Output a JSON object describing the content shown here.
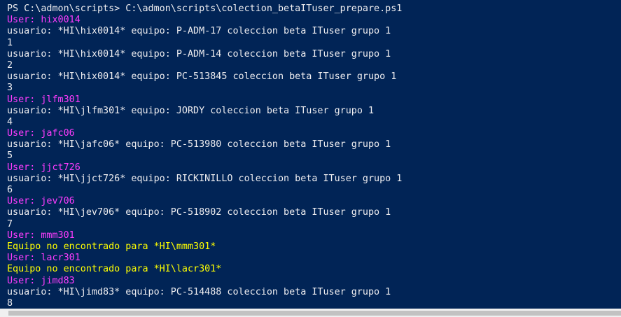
{
  "console": {
    "lines": [
      {
        "kind": "normal",
        "text": "PS C:\\admon\\scripts> C:\\admon\\scripts\\colection_betaITuser_prepare.ps1"
      },
      {
        "kind": "user",
        "text": "User: hix0014"
      },
      {
        "kind": "normal",
        "text": "usuario: *HI\\hix0014* equipo: P-ADM-17 coleccion beta ITuser grupo 1"
      },
      {
        "kind": "normal",
        "text": "1"
      },
      {
        "kind": "normal",
        "text": "usuario: *HI\\hix0014* equipo: P-ADM-14 coleccion beta ITuser grupo 1"
      },
      {
        "kind": "normal",
        "text": "2"
      },
      {
        "kind": "normal",
        "text": "usuario: *HI\\hix0014* equipo: PC-513845 coleccion beta ITuser grupo 1"
      },
      {
        "kind": "normal",
        "text": "3"
      },
      {
        "kind": "user",
        "text": "User: jlfm301"
      },
      {
        "kind": "normal",
        "text": "usuario: *HI\\jlfm301* equipo: JORDY coleccion beta ITuser grupo 1"
      },
      {
        "kind": "normal",
        "text": "4"
      },
      {
        "kind": "user",
        "text": "User: jafc06"
      },
      {
        "kind": "normal",
        "text": "usuario: *HI\\jafc06* equipo: PC-513980 coleccion beta ITuser grupo 1"
      },
      {
        "kind": "normal",
        "text": "5"
      },
      {
        "kind": "user",
        "text": "User: jjct726"
      },
      {
        "kind": "normal",
        "text": "usuario: *HI\\jjct726* equipo: RICKINILLO coleccion beta ITuser grupo 1"
      },
      {
        "kind": "normal",
        "text": "6"
      },
      {
        "kind": "user",
        "text": "User: jev706"
      },
      {
        "kind": "normal",
        "text": "usuario: *HI\\jev706* equipo: PC-518902 coleccion beta ITuser grupo 1"
      },
      {
        "kind": "normal",
        "text": "7"
      },
      {
        "kind": "user",
        "text": "User: mmm301"
      },
      {
        "kind": "warn",
        "text": "Equipo no encontrado para *HI\\mmm301*"
      },
      {
        "kind": "user",
        "text": "User: lacr301"
      },
      {
        "kind": "warn",
        "text": "Equipo no encontrado para *HI\\lacr301*"
      },
      {
        "kind": "user",
        "text": "User: jimd83"
      },
      {
        "kind": "normal",
        "text": "usuario: *HI\\jimd83* equipo: PC-514488 coleccion beta ITuser grupo 1"
      },
      {
        "kind": "normal",
        "text": "8"
      }
    ]
  },
  "colors": {
    "background": "#012456",
    "text": "#eeedf0",
    "user_line": "#ff3cff",
    "warning_line": "#ffff00"
  }
}
